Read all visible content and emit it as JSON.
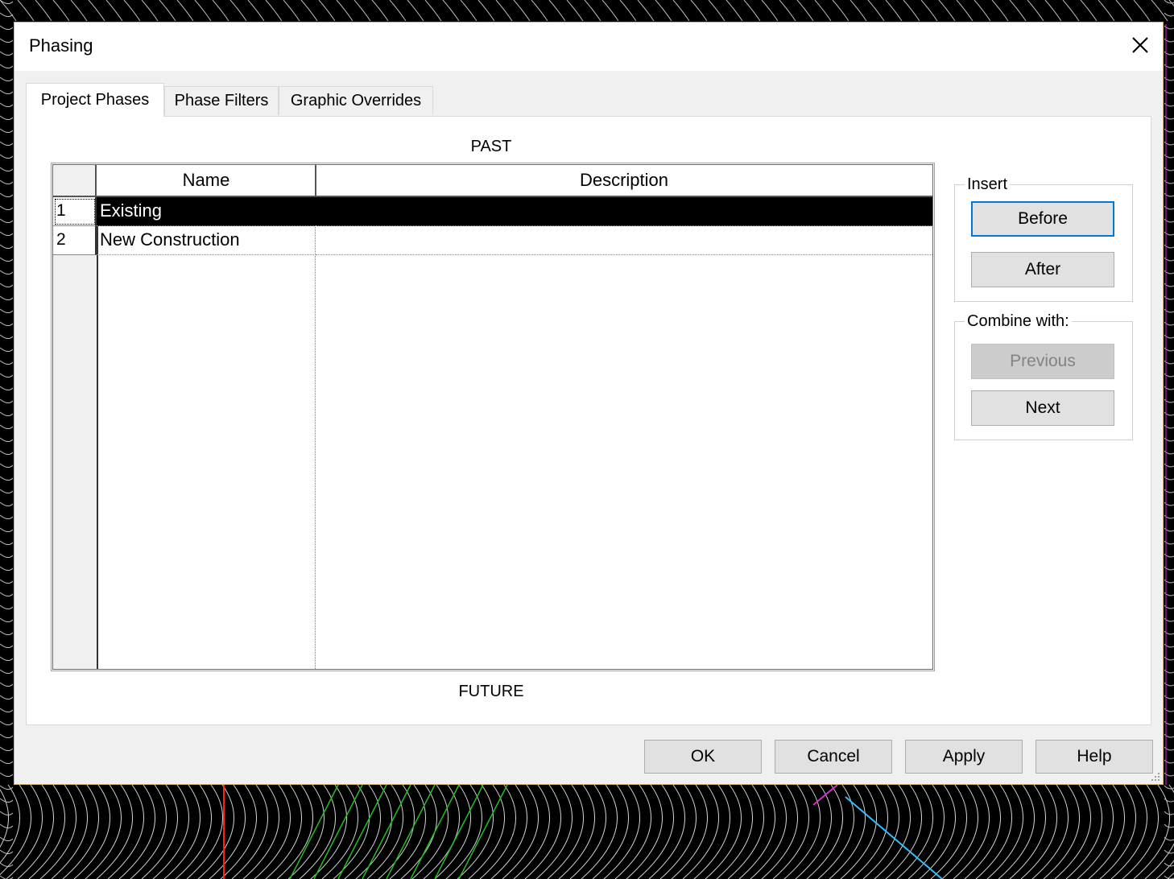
{
  "window": {
    "title": "Phasing"
  },
  "tabs": [
    {
      "label": "Project Phases",
      "active": true
    },
    {
      "label": "Phase Filters",
      "active": false
    },
    {
      "label": "Graphic Overrides",
      "active": false
    }
  ],
  "panel": {
    "past_label": "PAST",
    "future_label": "FUTURE",
    "grid": {
      "columns": [
        "Name",
        "Description"
      ],
      "rows": [
        {
          "num": "1",
          "name": "Existing",
          "description": "",
          "selected": true
        },
        {
          "num": "2",
          "name": "New Construction",
          "description": "",
          "selected": false
        }
      ]
    },
    "insert": {
      "label": "Insert",
      "before": "Before",
      "after": "After"
    },
    "combine": {
      "label": "Combine with:",
      "previous": "Previous",
      "next": "Next"
    }
  },
  "footer": {
    "ok": "OK",
    "cancel": "Cancel",
    "apply": "Apply",
    "help": "Help"
  },
  "icons": {
    "close": "close-icon",
    "resize": "resize-grip-icon"
  },
  "colors": {
    "selection": "#000000",
    "default_button_border": "#0078d7",
    "dialog_border": "#d6b56a"
  }
}
